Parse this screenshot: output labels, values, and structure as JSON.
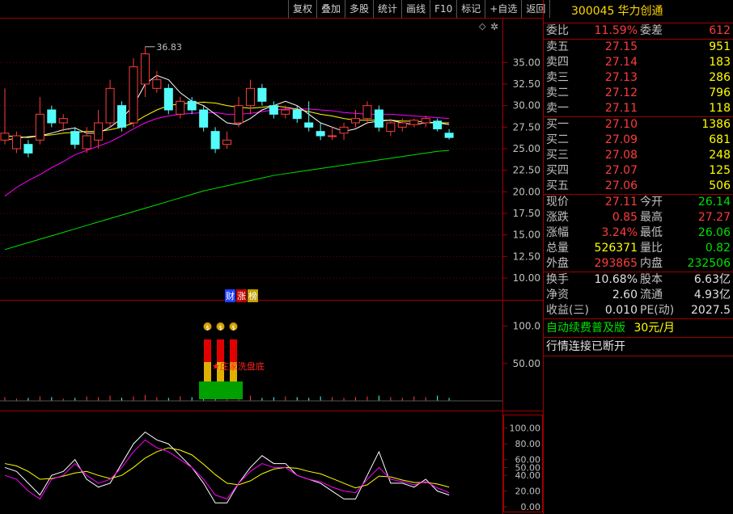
{
  "toolbar": [
    "复权",
    "叠加",
    "多股",
    "统计",
    "画线",
    "F10",
    "标记",
    "+自选",
    "返回"
  ],
  "price_axis": [
    "35.00",
    "32.50",
    "30.00",
    "27.50",
    "25.00",
    "22.50",
    "20.00",
    "17.50",
    "15.00",
    "12.50",
    "10.00"
  ],
  "vol_axis": [
    "100.0",
    "50.00"
  ],
  "kdj_axis": [
    "100.00",
    "80.00",
    "60.00",
    "50.00",
    "40.00",
    "20.00",
    "0.00"
  ],
  "high_mark": "36.83",
  "event_tags": [
    "财",
    "涨",
    "榜"
  ],
  "signal_text": "★庄家洗盘底",
  "colors": {
    "up": "#ff3c3c",
    "down": "#54fcfc",
    "ma5": "#ffffff",
    "ma10": "#ffff00",
    "ma20": "#ff00ff",
    "ma60": "#00e000",
    "frame": "#a00000"
  },
  "chart_data": {
    "type": "candlestick",
    "ylim": [
      8.5,
      38.5
    ],
    "candles": [
      {
        "o": 26.0,
        "c": 26.8,
        "h": 32.0,
        "l": 25.5
      },
      {
        "o": 25.0,
        "c": 26.5,
        "h": 27.0,
        "l": 24.5
      },
      {
        "o": 25.5,
        "c": 24.5,
        "h": 26.0,
        "l": 24.0
      },
      {
        "o": 26.0,
        "c": 29.0,
        "h": 31.0,
        "l": 25.5
      },
      {
        "o": 29.5,
        "c": 28.0,
        "h": 30.0,
        "l": 27.5
      },
      {
        "o": 28.0,
        "c": 28.5,
        "h": 29.0,
        "l": 27.0
      },
      {
        "o": 27.0,
        "c": 25.5,
        "h": 27.5,
        "l": 25.0
      },
      {
        "o": 25.0,
        "c": 26.5,
        "h": 27.5,
        "l": 24.5
      },
      {
        "o": 26.0,
        "c": 28.0,
        "h": 29.5,
        "l": 25.0
      },
      {
        "o": 28.0,
        "c": 32.0,
        "h": 33.0,
        "l": 27.5
      },
      {
        "o": 30.0,
        "c": 27.5,
        "h": 30.5,
        "l": 27.0
      },
      {
        "o": 28.0,
        "c": 34.5,
        "h": 35.5,
        "l": 27.5
      },
      {
        "o": 32.5,
        "c": 36.0,
        "h": 36.83,
        "l": 31.0
      },
      {
        "o": 32.0,
        "c": 33.0,
        "h": 34.0,
        "l": 31.5
      },
      {
        "o": 32.0,
        "c": 29.5,
        "h": 32.5,
        "l": 29.0
      },
      {
        "o": 29.0,
        "c": 30.5,
        "h": 31.0,
        "l": 28.5
      },
      {
        "o": 30.5,
        "c": 29.5,
        "h": 31.0,
        "l": 29.0
      },
      {
        "o": 29.5,
        "c": 27.5,
        "h": 30.0,
        "l": 27.0
      },
      {
        "o": 27.0,
        "c": 25.0,
        "h": 27.5,
        "l": 24.5
      },
      {
        "o": 25.5,
        "c": 26.0,
        "h": 27.0,
        "l": 25.0
      },
      {
        "o": 28.0,
        "c": 30.0,
        "h": 31.0,
        "l": 27.5
      },
      {
        "o": 30.0,
        "c": 32.0,
        "h": 33.0,
        "l": 29.0
      },
      {
        "o": 32.0,
        "c": 30.5,
        "h": 32.5,
        "l": 30.0
      },
      {
        "o": 30.0,
        "c": 29.0,
        "h": 30.5,
        "l": 28.5
      },
      {
        "o": 29.0,
        "c": 29.5,
        "h": 30.0,
        "l": 28.5
      },
      {
        "o": 29.5,
        "c": 28.5,
        "h": 30.0,
        "l": 28.0
      },
      {
        "o": 28.0,
        "c": 27.5,
        "h": 30.5,
        "l": 27.0
      },
      {
        "o": 27.0,
        "c": 26.5,
        "h": 28.0,
        "l": 26.0
      },
      {
        "o": 26.5,
        "c": 26.5,
        "h": 27.5,
        "l": 26.0
      },
      {
        "o": 26.8,
        "c": 27.5,
        "h": 28.0,
        "l": 26.0
      },
      {
        "o": 28.0,
        "c": 28.5,
        "h": 29.5,
        "l": 27.5
      },
      {
        "o": 28.5,
        "c": 30.0,
        "h": 30.5,
        "l": 28.0
      },
      {
        "o": 29.5,
        "c": 27.5,
        "h": 30.0,
        "l": 27.0
      },
      {
        "o": 27.0,
        "c": 28.0,
        "h": 28.5,
        "l": 26.5
      },
      {
        "o": 27.5,
        "c": 28.0,
        "h": 28.5,
        "l": 27.0
      },
      {
        "o": 27.8,
        "c": 28.3,
        "h": 28.5,
        "l": 27.5
      },
      {
        "o": 28.0,
        "c": 28.5,
        "h": 28.8,
        "l": 27.5
      },
      {
        "o": 28.2,
        "c": 27.3,
        "h": 28.5,
        "l": 27.0
      },
      {
        "o": 26.8,
        "c": 26.3,
        "h": 27.27,
        "l": 26.06
      }
    ],
    "ma5": [
      26.5,
      26.4,
      26.3,
      26.5,
      26.8,
      27.2,
      27.4,
      26.8,
      26.8,
      27.5,
      28.5,
      30.0,
      32.5,
      33.5,
      33.0,
      31.5,
      30.5,
      30.0,
      29.0,
      28.0,
      27.8,
      28.5,
      29.5,
      30.0,
      30.5,
      30.0,
      29.0,
      28.0,
      27.5,
      27.0,
      27.3,
      28.0,
      28.2,
      28.3,
      28.0,
      27.8,
      28.0,
      28.0,
      27.8
    ],
    "ma10": [
      26.0,
      26.2,
      26.4,
      26.5,
      26.6,
      26.8,
      26.9,
      27.0,
      27.0,
      27.2,
      27.5,
      28.0,
      28.8,
      29.5,
      30.0,
      30.2,
      30.3,
      30.4,
      30.3,
      30.0,
      29.8,
      29.7,
      29.8,
      30.0,
      29.8,
      29.6,
      29.3,
      29.0,
      28.8,
      28.5,
      28.3,
      28.3,
      28.3,
      28.3,
      28.2,
      28.2,
      28.1,
      28.0,
      28.0
    ],
    "ma20": [
      19.5,
      20.5,
      21.3,
      22.0,
      22.8,
      23.5,
      24.3,
      24.8,
      25.3,
      25.8,
      26.5,
      27.3,
      28.0,
      28.5,
      28.8,
      29.0,
      29.1,
      29.2,
      29.2,
      29.0,
      29.0,
      29.1,
      29.3,
      29.5,
      29.6,
      29.6,
      29.6,
      29.5,
      29.4,
      29.2,
      29.1,
      29.0,
      29.0,
      29.0,
      28.9,
      28.8,
      28.7,
      28.6,
      28.5
    ],
    "ma60": [
      13.3,
      13.7,
      14.1,
      14.5,
      14.9,
      15.3,
      15.7,
      16.1,
      16.5,
      16.9,
      17.3,
      17.7,
      18.1,
      18.5,
      18.9,
      19.3,
      19.7,
      20.1,
      20.4,
      20.7,
      21.0,
      21.3,
      21.6,
      21.9,
      22.1,
      22.3,
      22.5,
      22.7,
      22.9,
      23.1,
      23.3,
      23.5,
      23.7,
      23.9,
      24.1,
      24.3,
      24.5,
      24.7,
      24.8
    ],
    "volume_ylim": [
      0,
      120
    ],
    "volume": [
      5,
      3,
      4,
      6,
      5,
      3,
      4,
      6,
      5,
      7,
      4,
      6,
      8,
      5,
      4,
      6,
      5,
      4,
      5,
      6,
      5,
      7,
      4,
      5,
      6,
      5,
      4,
      6,
      5,
      4,
      5,
      6,
      7,
      5,
      4,
      6,
      5,
      7,
      4
    ],
    "kdj_ylim": [
      -5,
      110
    ],
    "k": [
      50,
      45,
      30,
      15,
      40,
      45,
      60,
      35,
      25,
      30,
      55,
      80,
      95,
      85,
      80,
      65,
      50,
      30,
      5,
      5,
      30,
      50,
      65,
      55,
      55,
      40,
      35,
      30,
      20,
      10,
      10,
      40,
      70,
      30,
      30,
      25,
      35,
      20,
      15
    ],
    "d": [
      55,
      52,
      45,
      35,
      36,
      39,
      43,
      45,
      40,
      36,
      40,
      50,
      62,
      70,
      75,
      72,
      66,
      54,
      41,
      30,
      28,
      33,
      42,
      48,
      50,
      49,
      45,
      42,
      36,
      30,
      24,
      28,
      39,
      38,
      34,
      31,
      31,
      29,
      25
    ],
    "j": [
      40,
      35,
      20,
      10,
      35,
      40,
      55,
      40,
      30,
      35,
      50,
      70,
      85,
      75,
      70,
      60,
      50,
      35,
      15,
      10,
      30,
      45,
      55,
      50,
      50,
      40,
      35,
      32,
      25,
      20,
      18,
      35,
      50,
      35,
      32,
      28,
      32,
      24,
      18
    ]
  },
  "quote": {
    "code": "300045",
    "name": "华力创通",
    "wb": {
      "l1": "委比",
      "v1": "11.59%",
      "l2": "委差",
      "v2": "612"
    },
    "sell": [
      {
        "l": "卖五",
        "p": "27.15",
        "v": "951"
      },
      {
        "l": "卖四",
        "p": "27.14",
        "v": "183"
      },
      {
        "l": "卖三",
        "p": "27.13",
        "v": "286"
      },
      {
        "l": "卖二",
        "p": "27.12",
        "v": "796"
      },
      {
        "l": "卖一",
        "p": "27.11",
        "v": "118"
      }
    ],
    "buy": [
      {
        "l": "买一",
        "p": "27.10",
        "v": "1386"
      },
      {
        "l": "买二",
        "p": "27.09",
        "v": "681"
      },
      {
        "l": "买三",
        "p": "27.08",
        "v": "248"
      },
      {
        "l": "买四",
        "p": "27.07",
        "v": "125"
      },
      {
        "l": "买五",
        "p": "27.06",
        "v": "506"
      }
    ],
    "stats": [
      {
        "l1": "现价",
        "v1": "27.11",
        "l2": "今开",
        "v2": "26.14"
      },
      {
        "l1": "涨跌",
        "v1": "0.85",
        "l2": "最高",
        "v2": "27.27"
      },
      {
        "l1": "涨幅",
        "v1": "3.24%",
        "l2": "最低",
        "v2": "26.06"
      },
      {
        "l1": "总量",
        "v1": "526371",
        "l2": "量比",
        "v2": "0.82"
      },
      {
        "l1": "外盘",
        "v1": "293865",
        "l2": "内盘",
        "v2": "232506"
      }
    ],
    "fin": [
      {
        "l1": "换手",
        "v1": "10.68%",
        "l2": "股本",
        "v2": "6.63亿"
      },
      {
        "l1": "净资",
        "v1": "2.60",
        "l2": "流通",
        "v2": "4.93亿"
      },
      {
        "l1": "收益(三)",
        "v1": "0.010",
        "l2": "PE(动)",
        "v2": "2027.5"
      }
    ],
    "ad": {
      "text": "自动续费普及版",
      "price": "30元/月"
    },
    "status": "行情连接已断开"
  }
}
